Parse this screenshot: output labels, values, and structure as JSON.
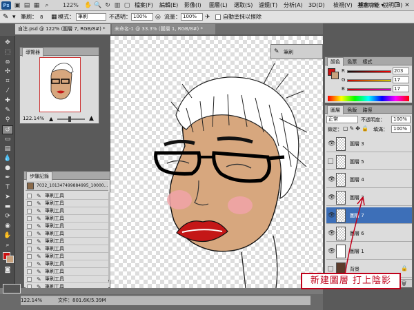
{
  "app": {
    "logo": "Ps",
    "zoom": "122%",
    "workspace": "基本功能 ▾"
  },
  "menus": [
    "檔案(F)",
    "編輯(E)",
    "影像(I)",
    "圖層(L)",
    "選取(S)",
    "濾鏡(T)",
    "分析(A)",
    "3D(D)",
    "檢視(V)",
    "視窗(W)",
    "說明(H)"
  ],
  "options": {
    "brush_label": "筆刷：",
    "brush_size": "8",
    "mode_label": "模式：",
    "mode_value": "筆刷",
    "opacity_label": "不透明：",
    "opacity_value": "100%",
    "flow_label": "流量：",
    "flow_value": "100%",
    "erase_label": "自動塗抹以擦除"
  },
  "tabs": [
    "自注.psd @ 122% (圖層 7, RGB/8#) *",
    "未命名-1 @ 33.3% (圖層 1, RGB/8#) *"
  ],
  "navigator": {
    "title": "導覽器",
    "zoom": "122.14%"
  },
  "history": {
    "title": "步驟記錄",
    "snapshot": "7032_101347499884995_10000...",
    "items": [
      "筆刷工具",
      "筆刷工具",
      "筆刷工具",
      "筆刷工具",
      "筆刷工具",
      "筆刷工具",
      "筆刷工具",
      "筆刷工具",
      "筆刷工具",
      "筆刷工具",
      "筆刷工具",
      "筆刷工具",
      "筆刷工具"
    ]
  },
  "brush_panel": {
    "label": "筆刷"
  },
  "color_panel": {
    "tabs": [
      "顏色",
      "色票",
      "樣式"
    ],
    "r_label": "R",
    "r_value": "203",
    "g_label": "G",
    "g_value": "17",
    "b_label": "B",
    "b_value": "17",
    "fg_color": "#cb1111",
    "bg_color": "#c8a27d"
  },
  "layers_panel": {
    "tabs": [
      "圖層",
      "色版",
      "路徑"
    ],
    "blend": "正常",
    "opacity_label": "不透明度：",
    "opacity": "100%",
    "lock_label": "鎖定：",
    "fill_label": "填滿：",
    "fill": "100%",
    "layers": [
      {
        "name": "圖層 3",
        "visible": true,
        "selected": false
      },
      {
        "name": "圖層 5",
        "visible": false,
        "selected": false
      },
      {
        "name": "圖層 4",
        "visible": true,
        "selected": false
      },
      {
        "name": "圖層 2",
        "visible": true,
        "selected": false
      },
      {
        "name": "圖層 7",
        "visible": true,
        "selected": true
      },
      {
        "name": "圖層 6",
        "visible": true,
        "selected": false
      },
      {
        "name": "圖層 1",
        "visible": true,
        "selected": false
      },
      {
        "name": "背景",
        "visible": false,
        "selected": false
      }
    ]
  },
  "status": {
    "zoom": "122.14%",
    "doc": "文件：801.6K/5.39M"
  },
  "annotation": "新建圖層 打上陰影",
  "colors": {
    "skin": "#d7a77e",
    "lips": "#c41717",
    "blush": "#f1a3a8",
    "selection": "#3d6fb8",
    "annotation": "#c0001a"
  }
}
